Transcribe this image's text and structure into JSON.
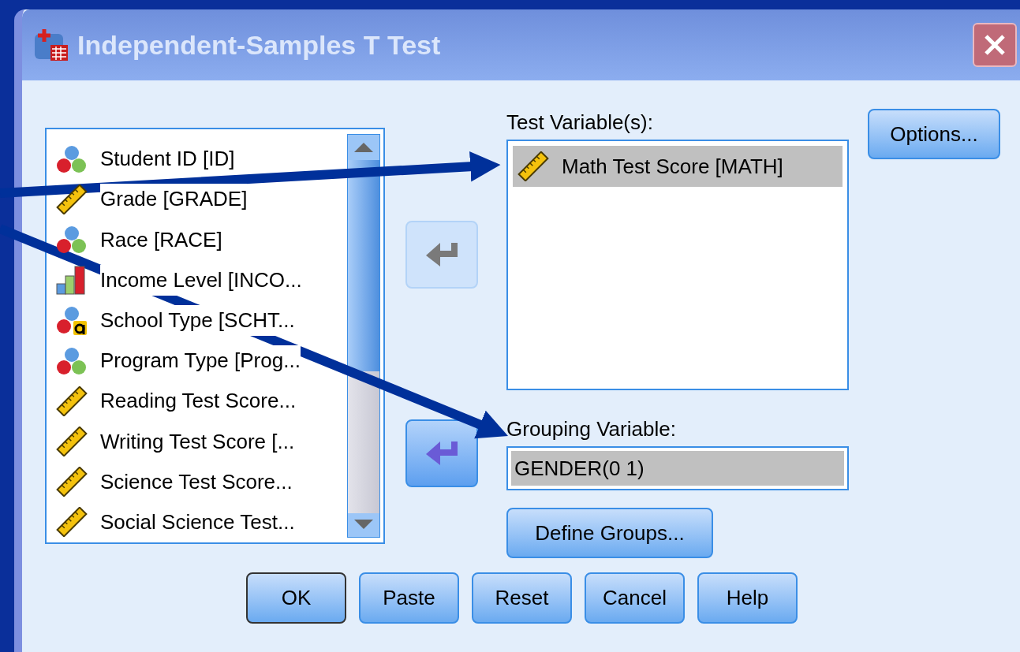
{
  "window": {
    "title": "Independent-Samples T Test"
  },
  "variables": [
    {
      "label": "Student ID [ID]",
      "kind": "nominal"
    },
    {
      "label": "Grade [GRADE]",
      "kind": "scale"
    },
    {
      "label": "Race [RACE]",
      "kind": "nominal"
    },
    {
      "label": "Income Level [INCO...",
      "kind": "ordinal"
    },
    {
      "label": "School Type [SCHT...",
      "kind": "string"
    },
    {
      "label": "Program Type [Prog...",
      "kind": "nominal"
    },
    {
      "label": "Reading Test Score...",
      "kind": "scale"
    },
    {
      "label": "Writing Test Score [...",
      "kind": "scale"
    },
    {
      "label": "Science Test Score...",
      "kind": "scale"
    },
    {
      "label": "Social Science Test...",
      "kind": "scale"
    }
  ],
  "move_buttons": [
    {
      "disabled": true
    },
    {
      "disabled": false
    }
  ],
  "test_variables": {
    "label": "Test Variable(s):",
    "items": [
      {
        "label": "Math Test Score [MATH]",
        "kind": "scale",
        "selected": true
      }
    ]
  },
  "grouping_variable": {
    "label": "Grouping Variable:",
    "value": "GENDER(0 1)"
  },
  "define_groups_button": "Define Groups...",
  "options_button": "Options...",
  "buttons": [
    {
      "label": "OK",
      "default": true
    },
    {
      "label": "Paste",
      "default": false
    },
    {
      "label": "Reset",
      "default": false
    },
    {
      "label": "Cancel",
      "default": false
    },
    {
      "label": "Help",
      "default": false
    }
  ]
}
